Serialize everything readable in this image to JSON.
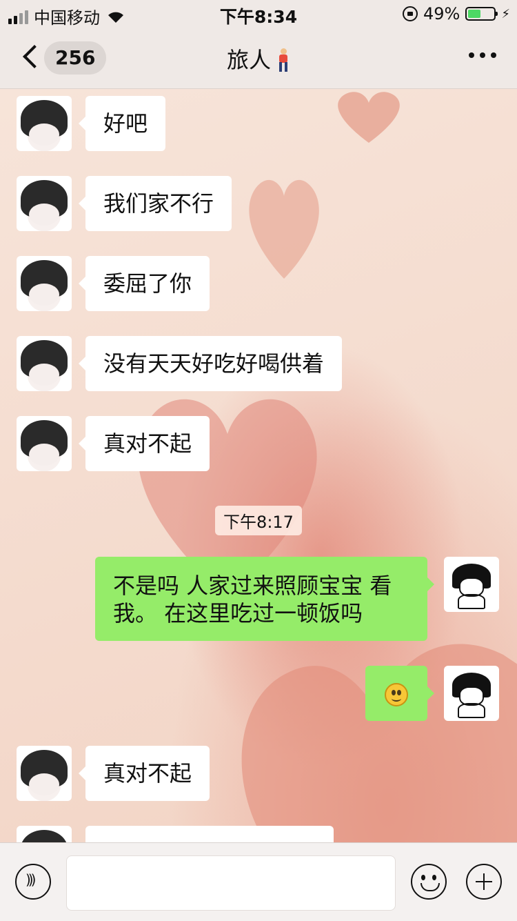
{
  "status_bar": {
    "carrier": "中国移动",
    "time": "下午8:34",
    "battery_percent": "49%",
    "battery_level": 0.49
  },
  "nav": {
    "back_count": "256",
    "title": "旅人",
    "title_emoji": "person-walking-icon"
  },
  "messages": [
    {
      "side": "left",
      "text": "好吧"
    },
    {
      "side": "left",
      "text": "我们家不行"
    },
    {
      "side": "left",
      "text": "委屈了你"
    },
    {
      "side": "left",
      "text": "没有天天好吃好喝供着"
    },
    {
      "side": "left",
      "text": "真对不起"
    },
    {
      "side": "right",
      "text": "不是吗 人家过来照顾宝宝 看我。   在这里吃过一顿饭吗"
    },
    {
      "side": "right",
      "text": "",
      "emoji": "smiley-icon"
    },
    {
      "side": "left",
      "text": "真对不起"
    }
  ],
  "timestamp": "下午8:17",
  "input_bar": {
    "placeholder": "",
    "voice_icon": "voice-icon",
    "emoji_icon": "emoji-icon",
    "plus_icon": "plus-icon"
  },
  "colors": {
    "my_bubble": "#95ec69",
    "their_bubble": "#ffffff",
    "battery_fill": "#4cd964"
  }
}
